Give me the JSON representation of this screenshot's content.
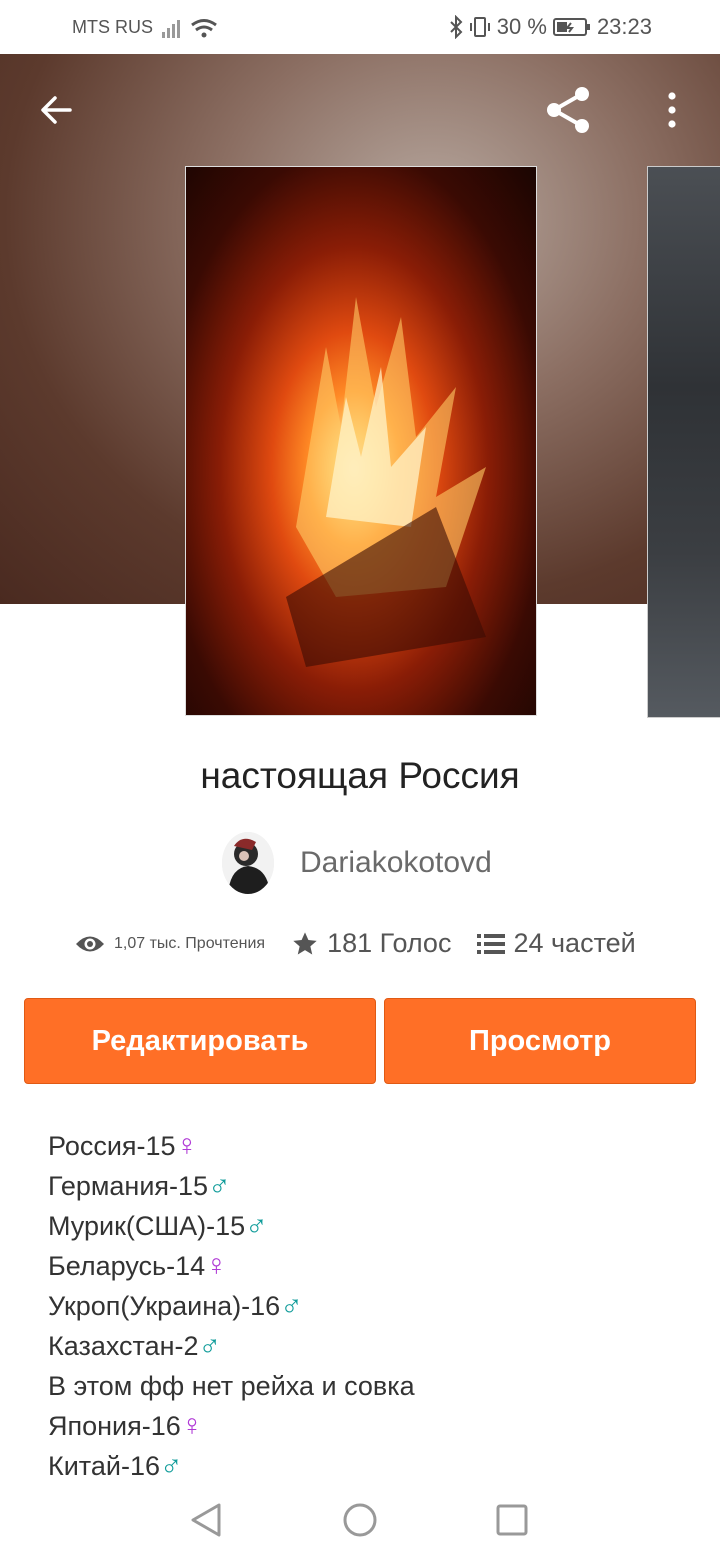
{
  "status_bar": {
    "carrier": "MTS RUS",
    "battery": "30 %",
    "time": "23:23"
  },
  "story": {
    "title": "настоящая Россия",
    "author": "Dariakokotovd",
    "reads": "1,07 тыс. Прочтения",
    "votes": "181 Голос",
    "parts": "24 частей"
  },
  "actions": {
    "edit_label": "Редактировать",
    "view_label": "Просмотр"
  },
  "description": {
    "lines": [
      {
        "text": "Россия-15",
        "symbol": "♀"
      },
      {
        "text": "Германия-15",
        "symbol": "♂"
      },
      {
        "text": "Мурик(США)-15",
        "symbol": "♂"
      },
      {
        "text": "Беларусь-14",
        "symbol": "♀"
      },
      {
        "text": "Укроп(Украина)-16",
        "symbol": "♂"
      },
      {
        "text": "Казахстан-2",
        "symbol": "♂"
      },
      {
        "text": "В этом фф нет рейха и совка",
        "symbol": ""
      },
      {
        "text": "Япония-16",
        "symbol": "♀"
      },
      {
        "text": "Китай-16",
        "symbol": "♂"
      }
    ]
  },
  "colors": {
    "accent": "#ff6f26",
    "female_symbol": "#b03ad6",
    "male_symbol": "#109c9a"
  },
  "icons": {
    "back": "arrow-left-icon",
    "share": "share-icon",
    "more": "more-vertical-icon",
    "reads": "eye-icon",
    "votes": "star-icon",
    "parts": "list-icon"
  }
}
